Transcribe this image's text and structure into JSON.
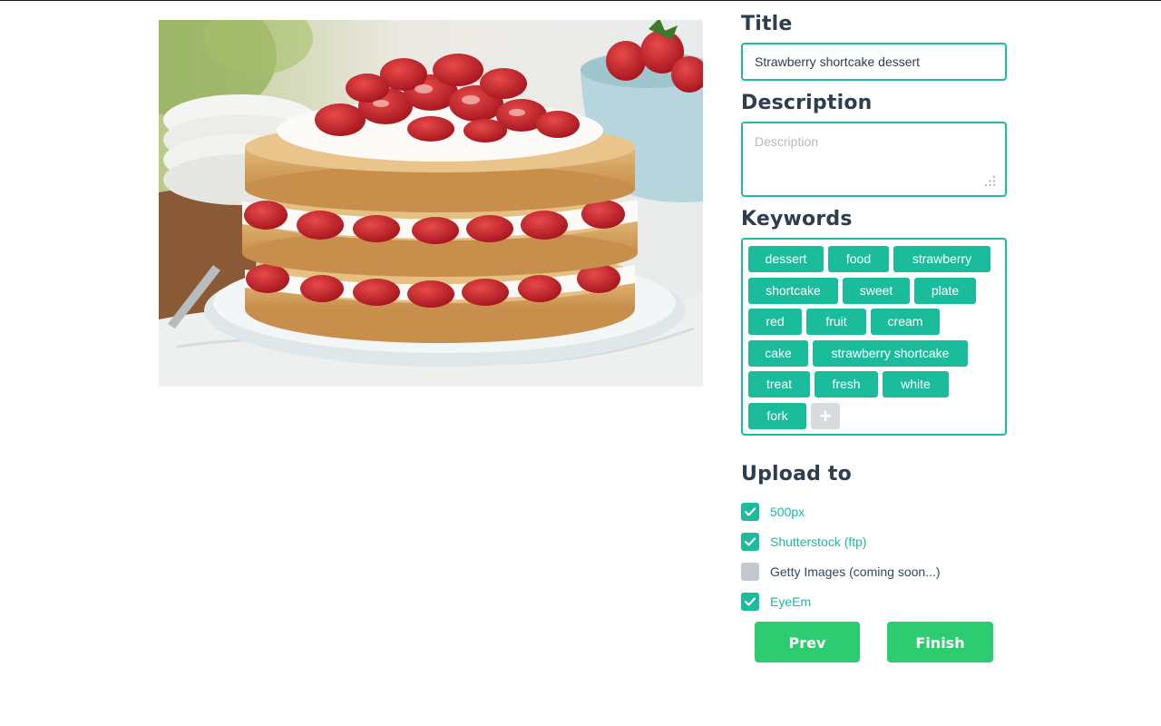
{
  "form": {
    "title_label": "Title",
    "title_value": "Strawberry shortcake dessert",
    "description_label": "Description",
    "description_placeholder": "Description",
    "keywords_label": "Keywords",
    "keywords": [
      [
        "dessert",
        "food",
        "strawberry"
      ],
      [
        "shortcake",
        "sweet",
        "plate"
      ],
      [
        "red",
        "fruit",
        "cream"
      ],
      [
        "cake",
        "strawberry shortcake"
      ],
      [
        "treat",
        "fresh",
        "white"
      ],
      [
        "fork"
      ]
    ],
    "add_keyword_symbol": "+",
    "upload_label": "Upload to",
    "upload_targets": [
      {
        "label": "500px",
        "checked": true
      },
      {
        "label": "Shutterstock (ftp)",
        "checked": true
      },
      {
        "label": "Getty Images (coming soon...)",
        "checked": false
      },
      {
        "label": "EyeEm",
        "checked": true
      }
    ],
    "prev_label": "Prev",
    "finish_label": "Finish"
  },
  "photo": {
    "subject": "strawberry-shortcake-photo"
  },
  "colors": {
    "accent": "#1abc9c",
    "heading": "#2c3e50",
    "button": "#2ecc71",
    "disabled": "#c3c9ce"
  }
}
